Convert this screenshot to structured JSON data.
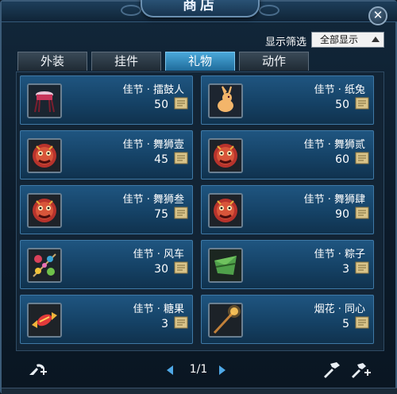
{
  "window": {
    "title": "商店",
    "close_label": "✕"
  },
  "filter": {
    "label": "显示筛选",
    "selected": "全部显示"
  },
  "tabs": [
    {
      "label": "外装",
      "active": false
    },
    {
      "label": "挂件",
      "active": false
    },
    {
      "label": "礼物",
      "active": true
    },
    {
      "label": "动作",
      "active": false
    }
  ],
  "items": [
    {
      "name": "佳节 · 擂鼓人",
      "price": "50",
      "icon": "drum-stool-icon"
    },
    {
      "name": "佳节 · 纸兔",
      "price": "50",
      "icon": "paper-rabbit-icon"
    },
    {
      "name": "佳节 · 舞狮壹",
      "price": "45",
      "icon": "lion-mask-icon"
    },
    {
      "name": "佳节 · 舞狮贰",
      "price": "60",
      "icon": "lion-mask-icon"
    },
    {
      "name": "佳节 · 舞狮叁",
      "price": "75",
      "icon": "lion-mask-icon"
    },
    {
      "name": "佳节 · 舞狮肆",
      "price": "90",
      "icon": "lion-mask-icon"
    },
    {
      "name": "佳节 · 风车",
      "price": "30",
      "icon": "pinwheel-icon"
    },
    {
      "name": "佳节 · 粽子",
      "price": "3",
      "icon": "zongzi-icon"
    },
    {
      "name": "佳节 · 糖果",
      "price": "3",
      "icon": "candy-icon"
    },
    {
      "name": "烟花 · 同心",
      "price": "5",
      "icon": "sparkler-icon"
    }
  ],
  "pagination": {
    "current": "1/1"
  },
  "colors": {
    "accent": "#4aa8da",
    "slot_bg": "#1f5580",
    "coin": "#d9c48a"
  }
}
